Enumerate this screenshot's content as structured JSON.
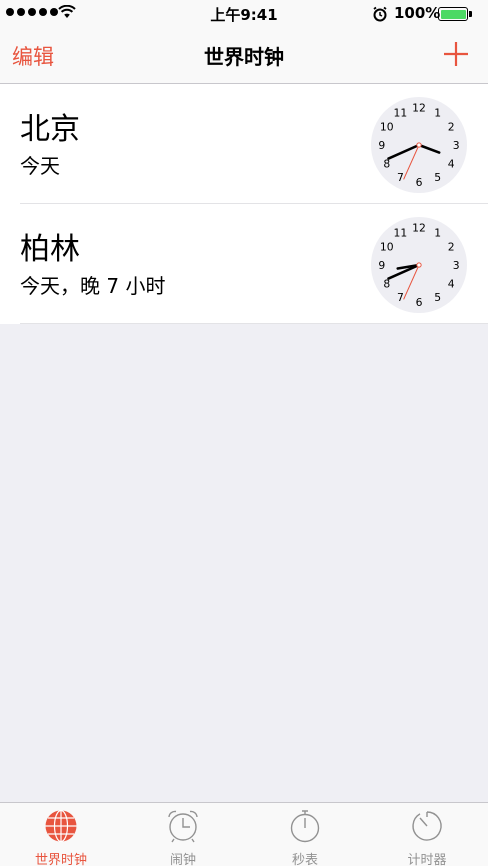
{
  "status_bar": {
    "time": "上午9:41",
    "battery": "100%"
  },
  "nav": {
    "edit_label": "编辑",
    "title": "世界时钟",
    "add_icon": "plus-icon"
  },
  "clocks": [
    {
      "city": "北京",
      "offset": "今天",
      "hour": 3,
      "minute": 41,
      "second": 34
    },
    {
      "city": "柏林",
      "offset": "今天，晚 7 小时",
      "hour": 8,
      "minute": 41,
      "second": 34
    }
  ],
  "tabs": [
    {
      "label": "世界时钟",
      "icon": "globe-icon",
      "active": true
    },
    {
      "label": "闹钟",
      "icon": "alarm-clock-icon",
      "active": false
    },
    {
      "label": "秒表",
      "icon": "stopwatch-icon",
      "active": false
    },
    {
      "label": "计时器",
      "icon": "timer-icon",
      "active": false
    }
  ],
  "colors": {
    "accent": "#e8553f",
    "tab_inactive": "#929292",
    "background": "#efeff4"
  }
}
